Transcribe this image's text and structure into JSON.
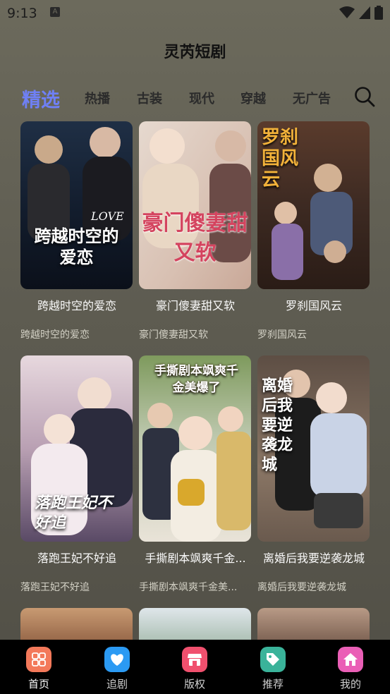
{
  "status_bar": {
    "time": "9:13",
    "notification_badge": "A"
  },
  "app_title": "灵芮短剧",
  "tabs": [
    {
      "label": "精选",
      "active": true
    },
    {
      "label": "热播"
    },
    {
      "label": "古装"
    },
    {
      "label": "现代"
    },
    {
      "label": "穿越"
    },
    {
      "label": "无广告"
    }
  ],
  "cards": [
    {
      "title": "跨越时空的爱恋",
      "subtitle": "跨越时空的爱恋",
      "poster_text": "跨越时空的爱恋",
      "poster_extra": "LOVE"
    },
    {
      "title": "豪门傻妻甜又软",
      "subtitle": "豪门傻妻甜又软",
      "poster_text": "豪门傻妻甜又软"
    },
    {
      "title": "罗刹国风云",
      "subtitle": "罗刹国风云",
      "poster_text": "罗刹国风云"
    },
    {
      "title": "落跑王妃不好追",
      "subtitle": "落跑王妃不好追",
      "poster_text": "落跑王妃不好追"
    },
    {
      "title": "手撕剧本飒爽千金...",
      "subtitle": "手撕剧本飒爽千金美...",
      "poster_text": "手撕剧本飒爽千金美爆了"
    },
    {
      "title": "离婚后我要逆袭龙城",
      "subtitle": "离婚后我要逆袭龙城",
      "poster_text": "离婚后我要逆袭龙城"
    }
  ],
  "bottom_nav": [
    {
      "label": "首页",
      "icon": "home-grid-icon",
      "color": "#f3795a",
      "active": true
    },
    {
      "label": "追剧",
      "icon": "heart-icon",
      "color": "#2b9af3"
    },
    {
      "label": "版权",
      "icon": "store-icon",
      "color": "#f0506e"
    },
    {
      "label": "推荐",
      "icon": "tag-icon",
      "color": "#3ab39a"
    },
    {
      "label": "我的",
      "icon": "house-icon",
      "color": "#ea5fb6"
    }
  ]
}
